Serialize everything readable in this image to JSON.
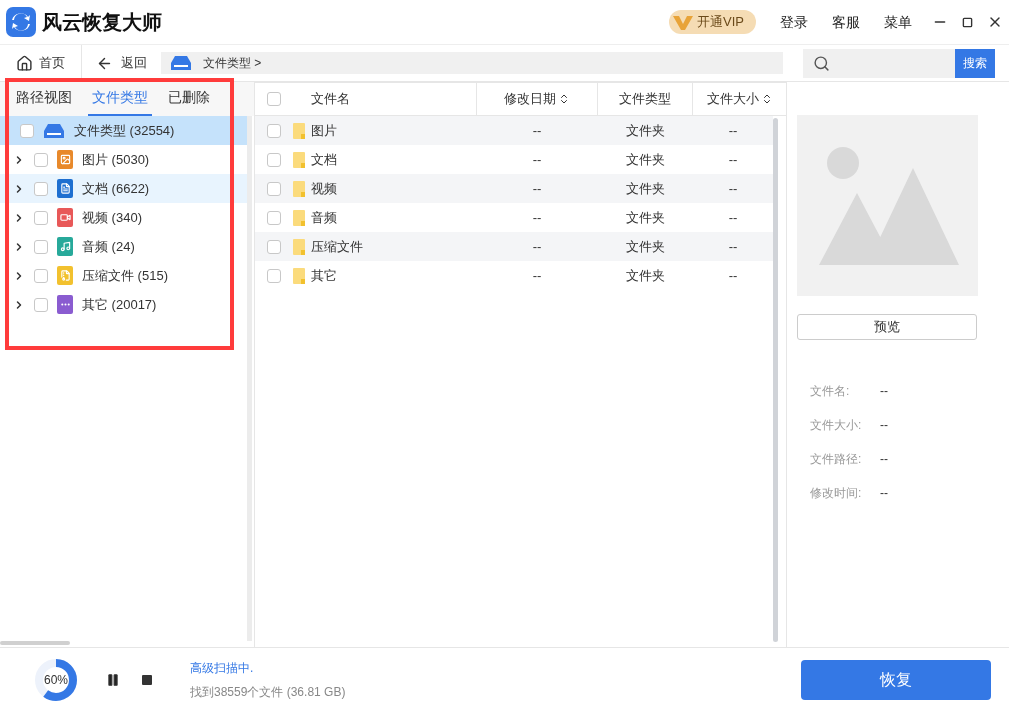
{
  "app": {
    "title": "风云恢复大师",
    "vip": "开通VIP",
    "menu": [
      "登录",
      "客服",
      "菜单"
    ]
  },
  "nav": {
    "home": "首页",
    "back": "返回",
    "path": "文件类型 >",
    "search_button": "搜索"
  },
  "left_tabs": [
    {
      "label": "路径视图",
      "selected": false
    },
    {
      "label": "文件类型",
      "selected": true
    },
    {
      "label": "已删除",
      "selected": false
    }
  ],
  "tree": {
    "label": "文件类型 (32554)",
    "selected": true,
    "checked": false,
    "children": [
      {
        "label": "图片 (5030)",
        "kind": "image",
        "color": "#e8892b",
        "checked": false,
        "highlighted": false
      },
      {
        "label": "文档 (6622)",
        "kind": "document",
        "color": "#1e6fd0",
        "checked": false,
        "highlighted": true
      },
      {
        "label": "视频 (340)",
        "kind": "video",
        "color": "#e85858",
        "checked": false,
        "highlighted": false
      },
      {
        "label": "音频 (24)",
        "kind": "audio",
        "color": "#27a99a",
        "checked": false,
        "highlighted": false
      },
      {
        "label": "压缩文件 (515)",
        "kind": "archive",
        "color": "#f2c12e",
        "checked": false,
        "highlighted": false
      },
      {
        "label": "其它 (20017)",
        "kind": "other",
        "color": "#8a5cd0",
        "checked": false,
        "highlighted": false
      }
    ]
  },
  "table": {
    "all_checked": false,
    "columns": [
      "文件名",
      "修改日期",
      "文件类型",
      "文件大小"
    ],
    "rows": [
      {
        "name": "图片",
        "date": "--",
        "type": "文件夹",
        "size": "--",
        "checked": false
      },
      {
        "name": "文档",
        "date": "--",
        "type": "文件夹",
        "size": "--",
        "checked": false
      },
      {
        "name": "视频",
        "date": "--",
        "type": "文件夹",
        "size": "--",
        "checked": false
      },
      {
        "name": "音频",
        "date": "--",
        "type": "文件夹",
        "size": "--",
        "checked": false
      },
      {
        "name": "压缩文件",
        "date": "--",
        "type": "文件夹",
        "size": "--",
        "checked": false
      },
      {
        "name": "其它",
        "date": "--",
        "type": "文件夹",
        "size": "--",
        "checked": false
      }
    ]
  },
  "preview": {
    "button": "预览",
    "fields": [
      {
        "label": "文件名:",
        "value": "--"
      },
      {
        "label": "文件大小:",
        "value": "--"
      },
      {
        "label": "文件路径:",
        "value": "--"
      },
      {
        "label": "修改时间:",
        "value": "--"
      }
    ]
  },
  "status": {
    "progress": {
      "level": 0.6,
      "reading": "60%"
    },
    "state": "高级扫描中.",
    "found": "找到38559个文件 (36.81 GB)",
    "recover_button": "恢复"
  },
  "annotation": {
    "frame": true
  }
}
